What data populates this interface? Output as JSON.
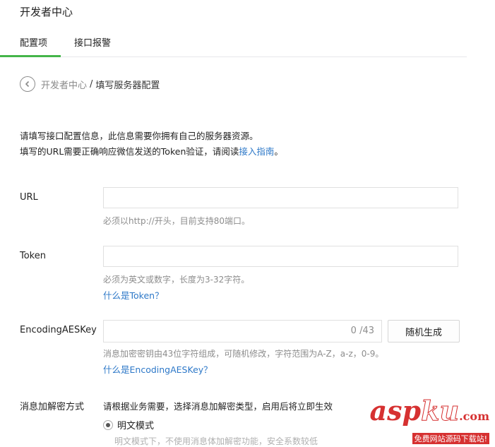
{
  "header": {
    "title": "开发者中心"
  },
  "tabs": [
    {
      "label": "配置项"
    },
    {
      "label": "接口报警"
    }
  ],
  "breadcrumb": {
    "parent": "开发者中心",
    "separator": "/",
    "current": "填写服务器配置"
  },
  "intro": {
    "line1": "请填写接口配置信息，此信息需要你拥有自己的服务器资源。",
    "line2_prefix": "填写的URL需要正确响应微信发送的Token验证，请阅读",
    "line2_link": "接入指南",
    "line2_suffix": "。"
  },
  "form": {
    "url": {
      "label": "URL",
      "value": "",
      "hint": "必须以http://开头，目前支持80端口。"
    },
    "token": {
      "label": "Token",
      "value": "",
      "hint": "必须为英文或数字，长度为3-32字符。",
      "link": "什么是Token？"
    },
    "aes": {
      "label": "EncodingAESKey",
      "value": "",
      "counter": "0 /43",
      "button": "随机生成",
      "hint": "消息加密密钥由43位字符组成，可随机修改，字符范围为A-Z，a-z，0-9。",
      "link": "什么是EncodingAESKey？"
    },
    "encryption": {
      "label": "消息加解密方式",
      "desc": "请根据业务需要，选择消息加解密类型，启用后将立即生效",
      "option": "明文模式",
      "option_desc_partial": "明文模式下，不使用消息体加解密功能，安全系数较低"
    }
  },
  "watermark": {
    "main_a": "asp",
    "main_b": "ku",
    "main_c": ".com",
    "sub": "免费网站源码下载站!"
  },
  "colors": {
    "accent": "#44b549",
    "link": "#2d78c8",
    "watermark": "#d63131"
  }
}
